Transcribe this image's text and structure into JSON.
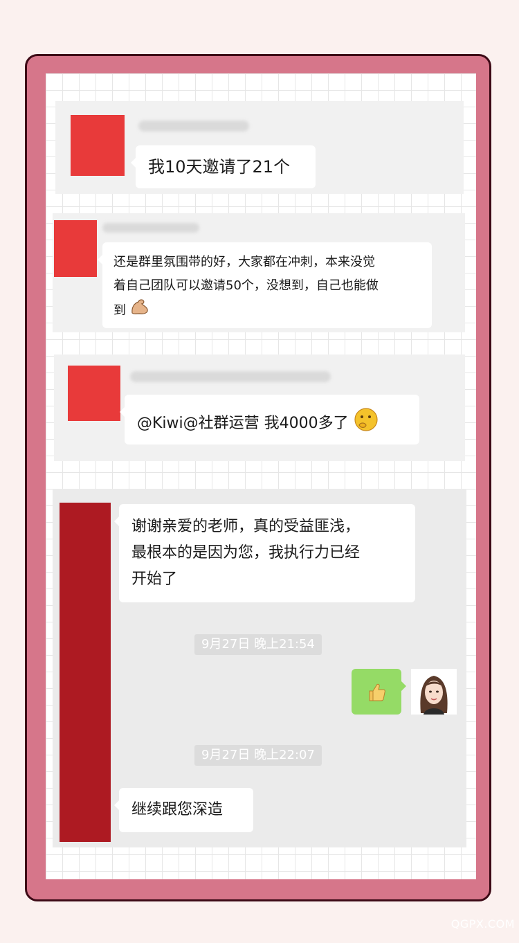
{
  "messages": [
    {
      "text": "我10天邀请了21个"
    },
    {
      "text_lines": [
        "还是群里氛围带的好，大家都在冲刺，本来没觉",
        "着自己团队可以邀请50个，没想到，自己也能做",
        "到"
      ],
      "emoji": "flexed-biceps"
    },
    {
      "text": "@Kiwi@社群运营 我4000多了",
      "emoji": "thinking-face"
    }
  ],
  "conversation": {
    "first_reply_lines": [
      "谢谢亲爱的老师，真的受益匪浅，",
      "最根本的是因为您，我执行力已经",
      "开始了"
    ],
    "timestamp_1": "9月27日 晚上21:54",
    "my_reply_emoji": "thumbs-up",
    "timestamp_2": "9月27日 晚上22:07",
    "second_reply": "继续跟您深造"
  },
  "watermark": "QGPX.COM",
  "colors": {
    "frame": "#d6768a",
    "avatar_red": "#e83a3a",
    "avatar_dark_red": "#ad1a22",
    "bubble_green": "#95db66"
  }
}
